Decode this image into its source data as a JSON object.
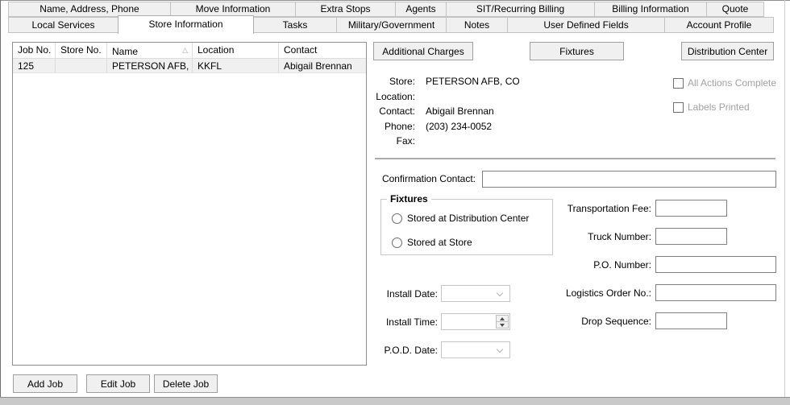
{
  "colors": {
    "tab_bg": "#f0f0f0",
    "tab_active_bg": "#ffffff",
    "selected_row_bg": "#f0f0f0",
    "disabled_label_text": "#a1a1a1",
    "button_bg": "#f0f0f0",
    "input_border": "#7f7f7f"
  },
  "tabs": {
    "row1": [
      {
        "label": "Name, Address, Phone"
      },
      {
        "label": "Move Information"
      },
      {
        "label": "Extra Stops"
      },
      {
        "label": "Agents"
      },
      {
        "label": "SIT/Recurring Billing"
      },
      {
        "label": "Billing Information"
      },
      {
        "label": "Quote"
      }
    ],
    "row2": [
      {
        "label": "Local Services",
        "active": false
      },
      {
        "label": "Store Information",
        "active": true
      },
      {
        "label": "Tasks",
        "active": false
      },
      {
        "label": "Military/Government",
        "active": false
      },
      {
        "label": "Notes",
        "active": false
      },
      {
        "label": "User Defined Fields",
        "active": false
      },
      {
        "label": "Account Profile",
        "active": false
      }
    ]
  },
  "jobs_table": {
    "columns": [
      "Job No.",
      "Store No.",
      "Name",
      "Location",
      "Contact"
    ],
    "sort_icon": "△",
    "rows": [
      {
        "job_no": "125",
        "store_no": "",
        "name": "PETERSON AFB, C",
        "location": "KKFL",
        "contact": "Abigail Brennan"
      }
    ]
  },
  "job_buttons": {
    "add": "Add Job",
    "edit": "Edit Job",
    "delete": "Delete Job"
  },
  "panel": {
    "action_buttons": {
      "additional_charges": "Additional Charges",
      "fixtures": "Fixtures",
      "distribution_center": "Distribution Center"
    },
    "store_info": [
      {
        "label": "Store:",
        "value": "PETERSON AFB, CO"
      },
      {
        "label": "Location:",
        "value": ""
      },
      {
        "label": "Contact:",
        "value": "Abigail Brennan"
      },
      {
        "label": "Phone:",
        "value": "(203) 234-0052"
      },
      {
        "label": "Fax:",
        "value": ""
      }
    ],
    "checkboxes": [
      {
        "label": "All Actions Complete",
        "checked": false
      },
      {
        "label": "Labels Printed",
        "checked": false
      }
    ],
    "confirmation_contact": {
      "label": "Confirmation Contact:",
      "value": ""
    },
    "fixtures_group": {
      "title": "Fixtures",
      "options": [
        {
          "label": "Stored at Distribution Center",
          "selected": false
        },
        {
          "label": "Stored at Store",
          "selected": false
        }
      ]
    },
    "schedule_fields": [
      {
        "label": "Install Date:",
        "value": "",
        "control": "combo"
      },
      {
        "label": "Install Time:",
        "value": "",
        "control": "spinner"
      },
      {
        "label": "P.O.D. Date:",
        "value": "",
        "control": "combo"
      }
    ],
    "logistics_fields": [
      {
        "label": "Transportation Fee:",
        "value": "",
        "size": "short"
      },
      {
        "label": "Truck Number:",
        "value": "",
        "size": "short"
      },
      {
        "label": "P.O. Number:",
        "value": "",
        "size": "long"
      },
      {
        "label": "Logistics Order No.:",
        "value": "",
        "size": "long"
      },
      {
        "label": "Drop Sequence:",
        "value": "",
        "size": "short"
      }
    ]
  }
}
